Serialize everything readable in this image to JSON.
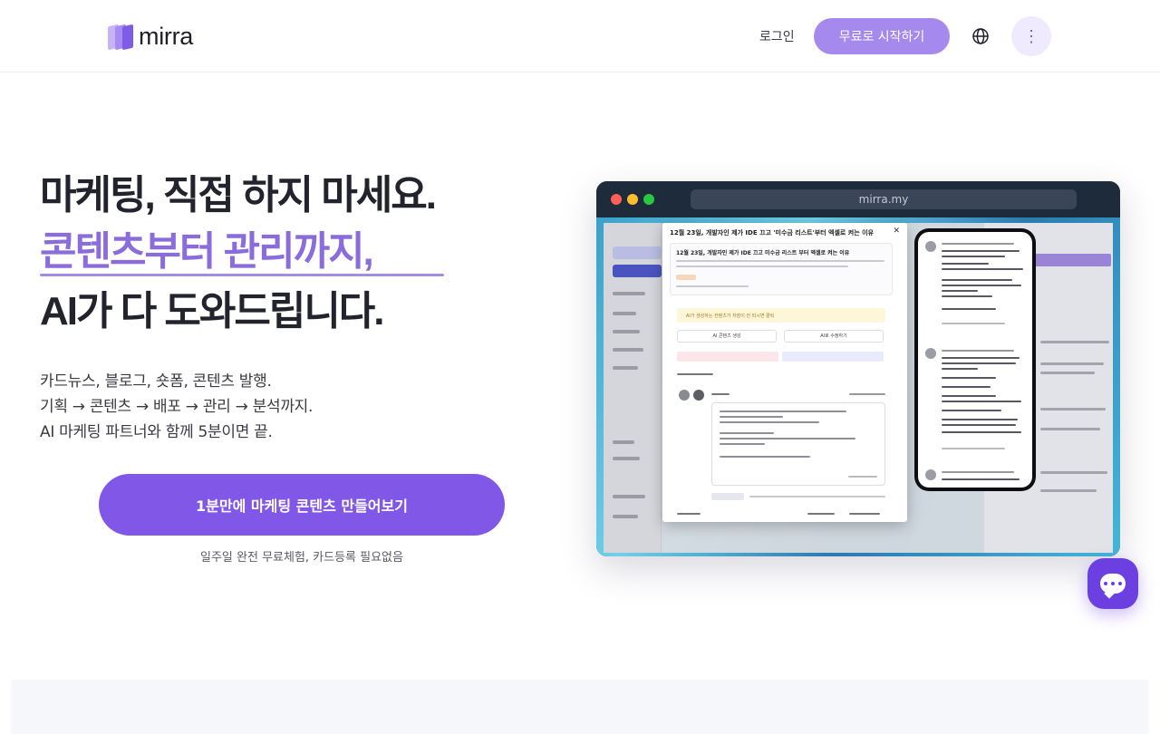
{
  "header": {
    "logo_text": "mirra",
    "login_label": "로그인",
    "start_label": "무료로 시작하기",
    "globe_icon": "globe-icon",
    "more_icon": "vertical-dots-icon",
    "more_glyph": "⋮"
  },
  "hero": {
    "headline_1": "마케팅, 직접 하지 마세요.",
    "headline_2": "콘텐츠부터 관리까지,",
    "headline_3": "AI가 다 도와드립니다.",
    "sub_1": "카드뉴스, 블로그, 숏폼, 콘텐츠 발행.",
    "sub_2": "기획 → 콘텐츠 → 배포 → 관리 → 분석까지.",
    "sub_3": "AI 마케팅 파트너와 함께 5분이면 끝.",
    "cta_label": "1분만에 마케팅 콘텐츠 만들어보기",
    "cta_note": "일주일 완전 무료체험, 카드등록 필요없음"
  },
  "mockup": {
    "url": "mirra.my",
    "modal_title": "12월 23일, 개발자인 제가 IDE 끄고 '미수금 리스트'부터 엑셀로 켜는 이유",
    "card_title": "12월 23일, 개발자인 제가 IDE 끄고 미수금 리스트 부터 엑셀로 켜는 이유",
    "notice": "AI가 생성하는 컨텐츠가 저장이 안 되시면 클릭",
    "btn_left": "AI 콘텐츠 생성",
    "btn_right": "AI로 수정하기"
  },
  "colors": {
    "brand": "#8057e6",
    "brand_light": "#a689ec",
    "headline_accent": "#8a6cdc",
    "chat": "#6b3fe0"
  },
  "chat": {
    "icon": "chat-bubble-icon"
  }
}
